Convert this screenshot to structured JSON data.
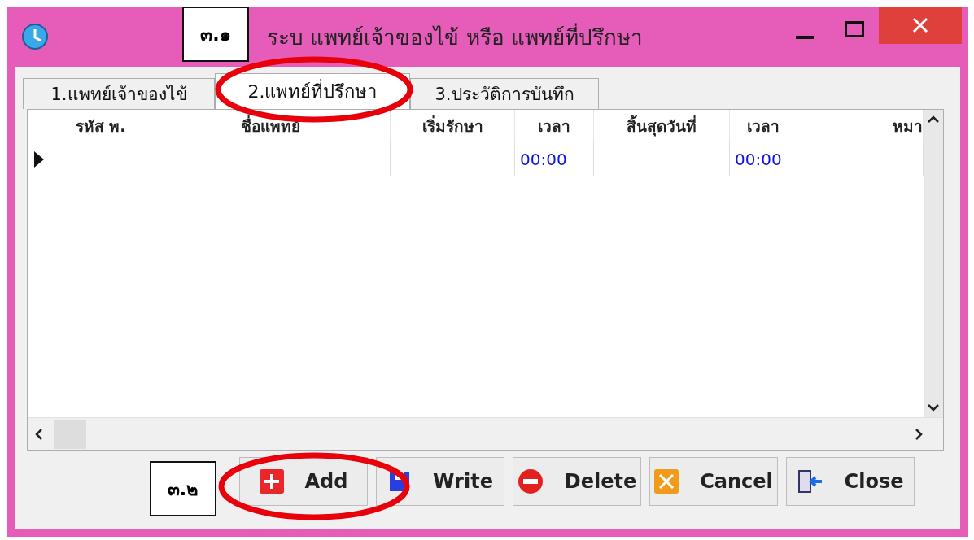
{
  "window": {
    "title": "ระบ แพทย์เจ้าของไข้ หรือ แพทย์ที่ปรึกษา"
  },
  "annotations": [
    {
      "label": "๓.๑"
    },
    {
      "label": "๓.๒"
    }
  ],
  "tabs": [
    {
      "label": "1.แพทย์เจ้าของไข้",
      "selected": false
    },
    {
      "label": "2.แพทย์ที่ปรึกษา",
      "selected": true
    },
    {
      "label": "3.ประวัติการบันทึก",
      "selected": false
    }
  ],
  "table": {
    "columns": [
      {
        "label": "รหัส พ.",
        "kind": "text"
      },
      {
        "label": "ชื่อแพทย์",
        "kind": "text"
      },
      {
        "label": "เริ่มรักษา",
        "kind": "text"
      },
      {
        "label": "เวลา",
        "kind": "time"
      },
      {
        "label": "สิ้นสุดวันที่",
        "kind": "text"
      },
      {
        "label": "เวลา",
        "kind": "time"
      },
      {
        "label": "หมา",
        "kind": "text"
      }
    ],
    "rows": [
      {
        "current": true,
        "cells": [
          "",
          "",
          "",
          "00:00",
          "",
          "00:00",
          ""
        ]
      }
    ]
  },
  "buttons": [
    {
      "label": "Add",
      "kind": "add"
    },
    {
      "label": "Write",
      "kind": "write"
    },
    {
      "label": "Delete",
      "kind": "delete"
    },
    {
      "label": "Cancel",
      "kind": "cancel"
    },
    {
      "label": "Close",
      "kind": "close"
    }
  ]
}
